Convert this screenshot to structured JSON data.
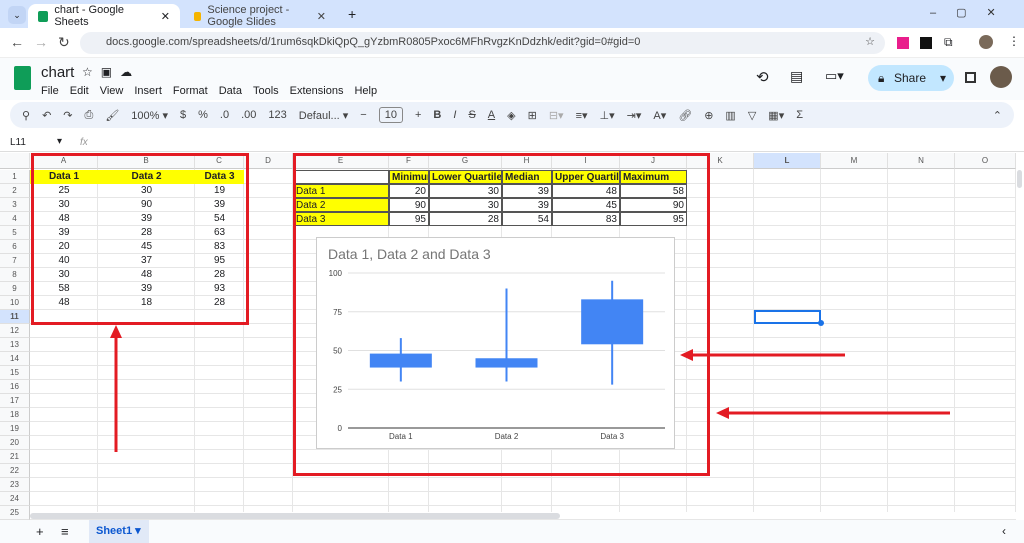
{
  "browser": {
    "tabs": [
      {
        "title": "chart - Google Sheets"
      },
      {
        "title": "Science project - Google Slides"
      }
    ],
    "url": "docs.google.com/spreadsheets/d/1rum6sqkDkiQpQ_gYzbmR0805Pxoc6MFhRvgzKnDdzhk/edit?gid=0#gid=0"
  },
  "app": {
    "doc_title": "chart",
    "menu": [
      "File",
      "Edit",
      "View",
      "Insert",
      "Format",
      "Data",
      "Tools",
      "Extensions",
      "Help"
    ],
    "share_label": "Share"
  },
  "toolbar": {
    "zoom": "100%",
    "currency": "$",
    "percent": "%",
    "dec_less": ".0",
    "dec_more": ".00",
    "number_format": "123",
    "font": "Defaul...",
    "font_size": "10"
  },
  "formula_bar": {
    "name_box": "L11",
    "fx": "fx"
  },
  "columns": [
    "A",
    "B",
    "C",
    "D",
    "E",
    "F",
    "G",
    "H",
    "I",
    "J",
    "K",
    "L",
    "M",
    "N",
    "O"
  ],
  "selected_cell": "L11",
  "source_table": {
    "headers": [
      "Data 1",
      "Data 2",
      "Data 3"
    ],
    "rows": [
      [
        "25",
        "30",
        "19"
      ],
      [
        "30",
        "90",
        "39"
      ],
      [
        "48",
        "39",
        "54"
      ],
      [
        "39",
        "28",
        "63"
      ],
      [
        "20",
        "45",
        "83"
      ],
      [
        "40",
        "37",
        "95"
      ],
      [
        "30",
        "48",
        "28"
      ],
      [
        "58",
        "39",
        "93"
      ],
      [
        "48",
        "18",
        "28"
      ]
    ]
  },
  "summary_table": {
    "headers": [
      "",
      "Minimum",
      "Lower Quartile",
      "Median",
      "Upper Quartile",
      "Maximum"
    ],
    "rows": [
      [
        "Data 1",
        "20",
        "30",
        "39",
        "48",
        "58"
      ],
      [
        "Data 2",
        "90",
        "30",
        "39",
        "45",
        "90"
      ],
      [
        "Data 3",
        "95",
        "28",
        "54",
        "83",
        "95"
      ]
    ]
  },
  "chart_data": {
    "type": "candlestick",
    "title": "Data 1, Data 2 and Data 3",
    "categories": [
      "Data 1",
      "Data 2",
      "Data 3"
    ],
    "low": [
      30,
      30,
      28
    ],
    "open": [
      39,
      39,
      54
    ],
    "close": [
      48,
      45,
      83
    ],
    "high": [
      58,
      90,
      95
    ],
    "ylim": [
      0,
      100
    ],
    "yticks": [
      "0",
      "25",
      "50",
      "75",
      "100"
    ],
    "grid": true,
    "color": "#4285f4"
  },
  "sheets": [
    {
      "name": "Sheet1"
    }
  ],
  "colors": {
    "header_fill": "#ffff00",
    "annotation": "#e31b23",
    "accent": "#1a73e8"
  }
}
